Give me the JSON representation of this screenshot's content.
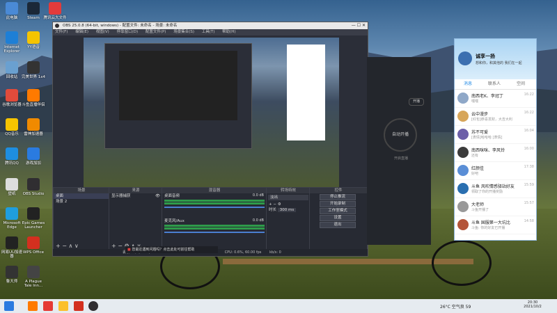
{
  "desktop": {
    "icons": [
      {
        "label": "此电脑",
        "icon": "computer-icon",
        "color": "#4a8ad6"
      },
      {
        "label": "Steam",
        "icon": "steam-icon",
        "color": "#1b2838"
      },
      {
        "label": "腾讯云大文件",
        "icon": "pdf-icon",
        "color": "#e23b3b"
      },
      {
        "label": "Internet Explorer",
        "icon": "ie-icon",
        "color": "#1e7fd6"
      },
      {
        "label": "YY语音",
        "icon": "yy-icon",
        "color": "#f5c400"
      },
      {
        "label": "回收站",
        "icon": "recycle-bin-icon",
        "color": "#6aa0d0"
      },
      {
        "label": "完美世界 1x4",
        "icon": "game-icon",
        "color": "#333"
      },
      {
        "label": "谷歌浏览器",
        "icon": "chrome-icon",
        "color": "#e04b3b"
      },
      {
        "label": "斗鱼直播伴侣",
        "icon": "douyu-icon",
        "color": "#ff7a00"
      },
      {
        "label": "QQ音乐",
        "icon": "qqmusic-icon",
        "color": "#f5c400"
      },
      {
        "label": "雷神加速器",
        "icon": "thunder-icon",
        "color": "#f08a00"
      },
      {
        "label": "腾讯QQ",
        "icon": "qq-icon",
        "color": "#1e8ee0"
      },
      {
        "label": "游戏加加",
        "icon": "game-plus-icon",
        "color": "#2a7be0"
      },
      {
        "label": "壁纸",
        "icon": "wallpaper-icon",
        "color": "#ddd"
      },
      {
        "label": "OBS Studio",
        "icon": "obs-icon",
        "color": "#302e31"
      },
      {
        "label": "Microsoft Edge",
        "icon": "edge-icon",
        "color": "#1f9ede"
      },
      {
        "label": "Epic Games Launcher",
        "icon": "epic-icon",
        "color": "#222"
      },
      {
        "label": "网易UU加速器",
        "icon": "uu-icon",
        "color": "#222"
      },
      {
        "label": "WPS Office",
        "icon": "wps-icon",
        "color": "#d3301f"
      },
      {
        "label": "鲁大师",
        "icon": "ludashi-icon",
        "color": "#333"
      },
      {
        "label": "A Plague Tale Inn...",
        "icon": "game-icon",
        "color": "#444"
      }
    ]
  },
  "obs": {
    "title": "OBS 25.0.8 (64-bit, windows) - 配置文件: 未命名 - 场景: 未命名",
    "menu": [
      "文件(F)",
      "编辑(E)",
      "视图(V)",
      "停靠窗口(D)",
      "配置文件(P)",
      "场景集合(S)",
      "工具(T)",
      "帮助(H)"
    ],
    "docks": {
      "scenes": {
        "title": "场景",
        "items": [
          "桌面",
          "场景 2"
        ]
      },
      "sources": {
        "title": "来源",
        "items": [
          "显示器捕获"
        ]
      },
      "mixer": {
        "title": "混音器",
        "channels": [
          {
            "name": "桌面音频",
            "db": "0.0 dB"
          },
          {
            "name": "麦克风/Aux",
            "db": "0.0 dB"
          }
        ]
      },
      "transitions": {
        "title": "转场特效",
        "type": "淡出",
        "duration_label": "时长",
        "duration": "300 ms"
      },
      "controls": {
        "title": "控件",
        "buttons": [
          "停止推流",
          "开始录制",
          "工作室模式",
          "设置",
          "退出"
        ]
      }
    },
    "notice": "您最近遇到问题吗？点击此处可前往帮助",
    "status": {
      "frames": "丢帧 12/0(0.0%)",
      "live": "LIVE: 00:00:00",
      "rec": "REC: 00:00:00",
      "cpu": "CPU: 0.6%, 60.00 fps",
      "kbps": "kb/s: 0"
    }
  },
  "stream_panel": {
    "button": "自动开播",
    "label": "开启直播",
    "sub": "开播"
  },
  "qq": {
    "user": "诚享一扬",
    "signature": "想和你，和其他的 我们在一起",
    "tabs": [
      "消息",
      "联系人",
      "空间"
    ],
    "conversations": [
      {
        "name": "南西老K、李冠丁",
        "msg": "嘿嘿",
        "time": "16:22",
        "color": "#8fa8c8"
      },
      {
        "name": "云中漫步",
        "msg": "[红包]恭喜发财，大吉大利",
        "time": "16:22",
        "color": "#d7a65a"
      },
      {
        "name": "苏不可爱",
        "msg": "[表情]哈哈哈 [表情]",
        "time": "16:04",
        "color": "#6c5fa8"
      },
      {
        "name": "南西咪咪、李风铃",
        "msg": "还有",
        "time": "16:00",
        "color": "#3b3b3b"
      },
      {
        "name": "红颜佳",
        "msg": "好吧",
        "time": "17:38",
        "color": "#5a8ed6"
      },
      {
        "name": "斗鱼 风吹情感驿站好友",
        "msg": "领取了你的开播奖励",
        "time": "15:59",
        "color": "#2a6fb0"
      },
      {
        "name": "大老师",
        "msg": "斗鱼开播了",
        "time": "15:57",
        "color": "#999"
      },
      {
        "name": "斗鱼 国服第一大坑比",
        "msg": "斗鱼: 你的好友已开播",
        "time": "14:58",
        "color": "#b4553a"
      }
    ]
  },
  "taskbar": {
    "weather": "26°C 空气良 59",
    "time": "20:30",
    "date": "2021/10/2"
  }
}
